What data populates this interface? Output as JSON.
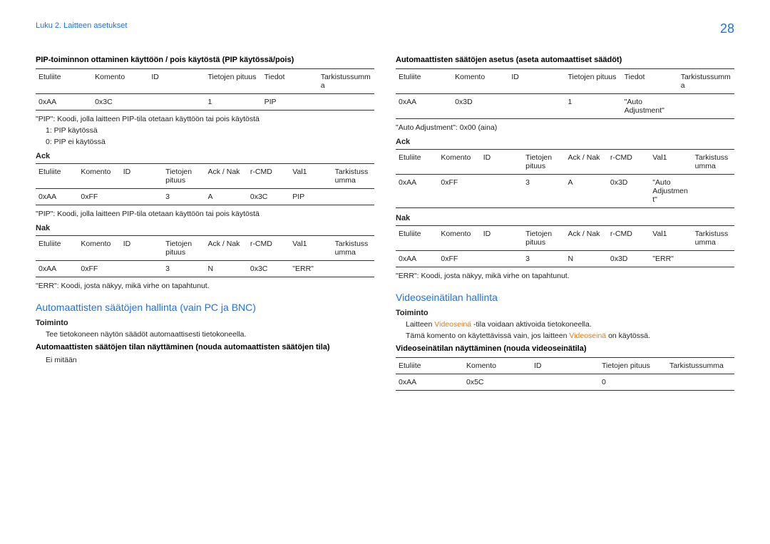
{
  "page_number": "28",
  "chapter": "Luku 2. Laitteen asetukset",
  "left": {
    "pip_heading": "PIP-toiminnon ottaminen käyttöön / pois käytöstä (PIP käytössä/pois)",
    "tbl1": {
      "h": [
        "Etuliite",
        "Komento",
        "ID",
        "Tietojen pituus",
        "Tiedot",
        "Tarkistussumma"
      ],
      "r": [
        "0xAA",
        "0x3C",
        "",
        "1",
        "PIP",
        ""
      ]
    },
    "pip_note": "\"PIP\": Koodi, jolla laitteen PIP-tila otetaan käyttöön tai pois käytöstä",
    "pip_list": [
      "1: PIP käytössä",
      "0: PIP ei käytössä"
    ],
    "ack_label": "Ack",
    "tbl2": {
      "h": [
        "Etuliite",
        "Komento",
        "ID",
        "Tietojen pituus",
        "Ack / Nak",
        "r-CMD",
        "Val1",
        "Tarkistussumma"
      ],
      "r": [
        "0xAA",
        "0xFF",
        "",
        "3",
        "A",
        "0x3C",
        "PIP",
        ""
      ]
    },
    "pip_note2": "\"PIP\": Koodi, jolla laitteen PIP-tila otetaan käyttöön tai pois käytöstä",
    "nak_label": "Nak",
    "tbl3": {
      "h": [
        "Etuliite",
        "Komento",
        "ID",
        "Tietojen pituus",
        "Ack / Nak",
        "r-CMD",
        "Val1",
        "Tarkistussumma"
      ],
      "r": [
        "0xAA",
        "0xFF",
        "",
        "3",
        "N",
        "0x3C",
        "\"ERR\"",
        ""
      ]
    },
    "err_note": "\"ERR\": Koodi, josta näkyy, mikä virhe on tapahtunut.",
    "auto_heading_blue": "Automaattisten säätöjen hallinta (vain PC ja BNC)",
    "toiminto": "Toiminto",
    "bullet1": "Tee tietokoneen näytön säädöt automaattisesti tietokoneella.",
    "auto_status_heading": "Automaattisten säätöjen tilan näyttäminen (nouda automaattisten säätöjen tila)",
    "bullet2": "Ei mitään"
  },
  "right": {
    "auto_set_heading": "Automaattisten säätöjen asetus (aseta automaattiset säädöt)",
    "tbl4": {
      "h": [
        "Etuliite",
        "Komento",
        "ID",
        "Tietojen pituus",
        "Tiedot",
        "Tarkistussumma"
      ],
      "r": [
        "0xAA",
        "0x3D",
        "",
        "1",
        "\"Auto Adjustment\"",
        ""
      ]
    },
    "auto_adj_note": "\"Auto Adjustment\": 0x00 (aina)",
    "ack_label": "Ack",
    "tbl5": {
      "h": [
        "Etuliite",
        "Komento",
        "ID",
        "Tietojen pituus",
        "Ack / Nak",
        "r-CMD",
        "Val1",
        "Tarkistussumma"
      ],
      "r": [
        "0xAA",
        "0xFF",
        "",
        "3",
        "A",
        "0x3D",
        "\"Auto Adjustment\"",
        ""
      ]
    },
    "nak_label": "Nak",
    "tbl6": {
      "h": [
        "Etuliite",
        "Komento",
        "ID",
        "Tietojen pituus",
        "Ack / Nak",
        "r-CMD",
        "Val1",
        "Tarkistussumma"
      ],
      "r": [
        "0xAA",
        "0xFF",
        "",
        "3",
        "N",
        "0x3D",
        "\"ERR\"",
        ""
      ]
    },
    "err_note": "\"ERR\": Koodi, josta näkyy, mikä virhe on tapahtunut.",
    "video_heading_blue": "Videoseinätilan hallinta",
    "toiminto": "Toiminto",
    "bullet1_pre": "Laitteen ",
    "bullet1_term": "Videoseinä",
    "bullet1_post": " -tila voidaan aktivoida tietokoneella.",
    "bullet2_pre": "Tämä komento on käytettävissä vain, jos laitteen ",
    "bullet2_term": "Videoseinä",
    "bullet2_post": " on käytössä.",
    "video_status_heading": "Videoseinätilan näyttäminen (nouda videoseinätila)",
    "tbl7": {
      "h": [
        "Etuliite",
        "Komento",
        "ID",
        "Tietojen pituus",
        "Tarkistussumma"
      ],
      "r": [
        "0xAA",
        "0x5C",
        "",
        "0",
        ""
      ]
    }
  }
}
